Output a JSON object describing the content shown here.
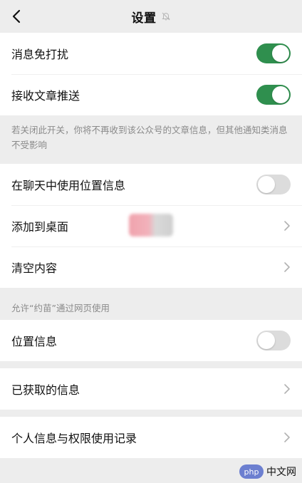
{
  "nav": {
    "title": "设置"
  },
  "group1": {
    "items": [
      {
        "label": "消息免打扰",
        "toggle": "on"
      },
      {
        "label": "接收文章推送",
        "toggle": "on"
      }
    ],
    "note": "若关闭此开关，你将不再收到该公众号的文章信息，但其他通知类消息不受影响"
  },
  "group2": {
    "items": [
      {
        "label": "在聊天中使用位置信息",
        "toggle": "off"
      },
      {
        "label": "添加到桌面",
        "chevron": true
      },
      {
        "label": "清空内容",
        "chevron": true
      }
    ]
  },
  "section_web": {
    "header": "允许“约苗”通过网页使用",
    "items": [
      {
        "label": "位置信息",
        "toggle": "off"
      }
    ]
  },
  "group_obtained": {
    "items": [
      {
        "label": "已获取的信息",
        "chevron": true
      }
    ]
  },
  "group_privacy": {
    "items": [
      {
        "label": "个人信息与权限使用记录",
        "chevron": true
      }
    ]
  },
  "watermark": {
    "brand": "php",
    "text": "中文网"
  },
  "colors": {
    "toggle_on": "#2f8f4e",
    "toggle_off": "#dcdcdc",
    "background": "#ededed"
  }
}
